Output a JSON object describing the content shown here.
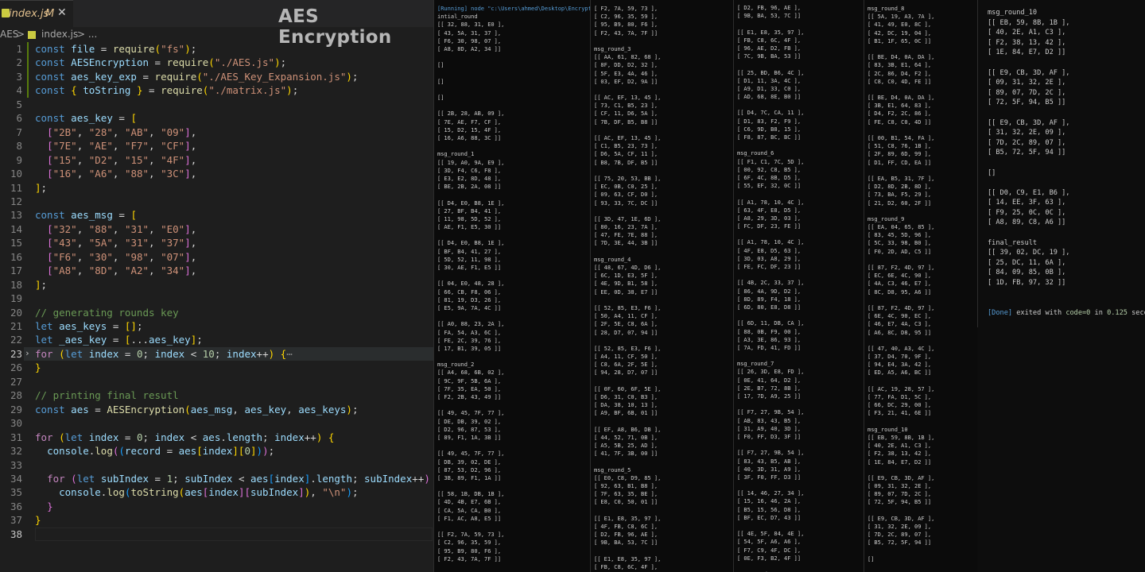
{
  "editor": {
    "tab_name": "index.js",
    "tab_modified": "M",
    "tab_close": "✕",
    "overlay_title": "AES Encryption",
    "breadcrumb": {
      "folder": "AES",
      "sep": ">",
      "file": "index.js",
      "tail": "> ..."
    },
    "folded_marker": "⋯",
    "lines": [
      {
        "n": "1",
        "html": "<span class='k'>const</span> <span class='v'>file</span> = <span class='f'>require</span><span class='b1'>(</span><span class='s'>\"fs\"</span><span class='b1'>)</span>;"
      },
      {
        "n": "2",
        "html": "<span class='k'>const</span> <span class='v'>AESEncryption</span> = <span class='f'>require</span><span class='b1'>(</span><span class='s'>\"./AES.js\"</span><span class='b1'>)</span>;"
      },
      {
        "n": "3",
        "html": "<span class='k'>const</span> <span class='v'>aes_key_exp</span> = <span class='f'>require</span><span class='b1'>(</span><span class='s'>\"./AES_Key_Expansion.js\"</span><span class='b1'>)</span>;"
      },
      {
        "n": "4",
        "html": "<span class='k'>const</span> <span class='b1'>{</span> <span class='v'>toString</span> <span class='b1'>}</span> = <span class='f'>require</span><span class='b1'>(</span><span class='s'>\"./matrix.js\"</span><span class='b1'>)</span>;"
      },
      {
        "n": "5",
        "html": ""
      },
      {
        "n": "6",
        "html": "<span class='k'>const</span> <span class='v'>aes_key</span> = <span class='b1'>[</span>"
      },
      {
        "n": "7",
        "html": "  <span class='b2'>[</span><span class='s'>\"2B\"</span>, <span class='s'>\"28\"</span>, <span class='s'>\"AB\"</span>, <span class='s'>\"09\"</span><span class='b2'>]</span>,"
      },
      {
        "n": "8",
        "html": "  <span class='b2'>[</span><span class='s'>\"7E\"</span>, <span class='s'>\"AE\"</span>, <span class='s'>\"F7\"</span>, <span class='s'>\"CF\"</span><span class='b2'>]</span>,"
      },
      {
        "n": "9",
        "html": "  <span class='b2'>[</span><span class='s'>\"15\"</span>, <span class='s'>\"D2\"</span>, <span class='s'>\"15\"</span>, <span class='s'>\"4F\"</span><span class='b2'>]</span>,"
      },
      {
        "n": "10",
        "html": "  <span class='b2'>[</span><span class='s'>\"16\"</span>, <span class='s'>\"A6\"</span>, <span class='s'>\"88\"</span>, <span class='s'>\"3C\"</span><span class='b2'>]</span>,"
      },
      {
        "n": "11",
        "html": "<span class='b1'>]</span>;"
      },
      {
        "n": "12",
        "html": ""
      },
      {
        "n": "13",
        "html": "<span class='k'>const</span> <span class='v'>aes_msg</span> = <span class='b1'>[</span>"
      },
      {
        "n": "14",
        "html": "  <span class='b2'>[</span><span class='s'>\"32\"</span>, <span class='s'>\"88\"</span>, <span class='s'>\"31\"</span>, <span class='s'>\"E0\"</span><span class='b2'>]</span>,"
      },
      {
        "n": "15",
        "html": "  <span class='b2'>[</span><span class='s'>\"43\"</span>, <span class='s'>\"5A\"</span>, <span class='s'>\"31\"</span>, <span class='s'>\"37\"</span><span class='b2'>]</span>,"
      },
      {
        "n": "16",
        "html": "  <span class='b2'>[</span><span class='s'>\"F6\"</span>, <span class='s'>\"30\"</span>, <span class='s'>\"98\"</span>, <span class='s'>\"07\"</span><span class='b2'>]</span>,"
      },
      {
        "n": "17",
        "html": "  <span class='b2'>[</span><span class='s'>\"A8\"</span>, <span class='s'>\"8D\"</span>, <span class='s'>\"A2\"</span>, <span class='s'>\"34\"</span><span class='b2'>]</span>,"
      },
      {
        "n": "18",
        "html": "<span class='b1'>]</span>;"
      },
      {
        "n": "19",
        "html": ""
      },
      {
        "n": "20",
        "html": "<span class='c'>// generating rounds key</span>"
      },
      {
        "n": "21",
        "html": "<span class='k'>let</span> <span class='v'>aes_keys</span> = <span class='b1'>[]</span>;"
      },
      {
        "n": "22",
        "html": "<span class='k'>let</span> <span class='v'>_aes_key</span> = <span class='b1'>[</span>...<span class='v'>aes_key</span><span class='b1'>]</span>;"
      },
      {
        "n": "23",
        "html": "<span class='cf'>for</span> <span class='b1'>(</span><span class='k'>let</span> <span class='v'>index</span> = <span class='n'>0</span>; <span class='v'>index</span> &lt; <span class='n'>10</span>; <span class='v'>index</span>++<span class='b1'>)</span> <span class='b1'>{</span><span class='fo'>⋯</span>"
      },
      {
        "n": "26",
        "html": "<span class='b1'>}</span>"
      },
      {
        "n": "27",
        "html": ""
      },
      {
        "n": "28",
        "html": "<span class='c'>// printing final resutl</span>"
      },
      {
        "n": "29",
        "html": "<span class='k'>const</span> <span class='v'>aes</span> = <span class='f'>AESEncryption</span><span class='b1'>(</span><span class='v'>aes_msg</span>, <span class='v'>aes_key</span>, <span class='v'>aes_keys</span><span class='b1'>)</span>;"
      },
      {
        "n": "30",
        "html": ""
      },
      {
        "n": "31",
        "html": "<span class='cf'>for</span> <span class='b1'>(</span><span class='k'>let</span> <span class='v'>index</span> = <span class='n'>0</span>; <span class='v'>index</span> &lt; <span class='v'>aes</span>.<span class='v'>length</span>; <span class='v'>index</span>++<span class='b1'>)</span> <span class='b1'>{</span>"
      },
      {
        "n": "32",
        "html": "  <span class='v'>console</span>.<span class='f'>log</span><span class='b2'>(</span><span class='b3'>(</span><span class='v'>record</span> = <span class='v'>aes</span><span class='b1'>[</span><span class='v'>index</span><span class='b1'>][</span><span class='n'>0</span><span class='b1'>]</span><span class='b3'>)</span><span class='b2'>)</span>;"
      },
      {
        "n": "33",
        "html": ""
      },
      {
        "n": "34",
        "html": "  <span class='cf'>for</span> <span class='b2'>(</span><span class='k'>let</span> <span class='v'>subIndex</span> = <span class='n'>1</span>; <span class='v'>subIndex</span> &lt; <span class='v'>aes</span><span class='b3'>[</span><span class='v'>index</span><span class='b3'>]</span>.<span class='v'>length</span>; <span class='v'>subIndex</span>++<span class='b2'>)</span> <span class='b2'>{</span>"
      },
      {
        "n": "35",
        "html": "    <span class='v'>console</span>.<span class='f'>log</span><span class='b3'>(</span><span class='f'>toString</span><span class='b1'>(</span><span class='v'>aes</span><span class='b2'>[</span><span class='v'>index</span><span class='b2'>][</span><span class='v'>subIndex</span><span class='b2'>]</span><span class='b1'>)</span>, <span class='s'>\"\\n\"</span><span class='b3'>)</span>;"
      },
      {
        "n": "36",
        "html": "  <span class='b2'>}</span>"
      },
      {
        "n": "37",
        "html": "<span class='b1'>}</span>"
      },
      {
        "n": "38",
        "html": ""
      }
    ]
  },
  "terminal": {
    "columns": [
      {
        "lines": [
          "[Running] node \"c:\\Users\\ahmed\\Desktop\\Encrypt",
          "intial_round",
          "[[ 32, 88, 31, E0 ],",
          "[ 43, 5A, 31, 37 ],",
          "[ F6, 30, 98, 07 ],",
          "[ A8, 8D, A2, 34 ]]",
          "",
          "[]",
          "",
          "[]",
          "",
          "[]",
          "",
          "[[ 2B, 28, AB, 09 ],",
          "[ 7E, AE, F7, CF ],",
          "[ 15, D2, 15, 4F ],",
          "[ 16, A6, 88, 3C ]]",
          "",
          "msg_round_1",
          "[[ 19, A0, 9A, E9 ],",
          "[ 3D, F4, C6, F8 ],",
          "[ E3, E2, 8D, 48 ],",
          "[ BE, 2B, 2A, 08 ]]",
          "",
          "[[ D4, E0, B8, 1E ],",
          "[ 27, BF, B4, 41 ],",
          "[ 11, 98, 5D, 52 ],",
          "[ AE, F1, E5, 30 ]]",
          "",
          "[[ D4, E0, B8, 1E ],",
          "[ BF, B4, 41, 27 ],",
          "[ 5D, 52, 11, 98 ],",
          "[ 30, AE, F1, E5 ]]",
          "",
          "[[ 04, E0, 48, 28 ],",
          "[ 66, CB, F8, 06 ],",
          "[ 81, 19, D3, 26 ],",
          "[ E5, 9A, 7A, 4C ]]",
          "",
          "[[ A0, 88, 23, 2A ],",
          "[ FA, 54, A3, 6C ],",
          "[ FE, 2C, 39, 76 ],",
          "[ 17, B1, 39, 05 ]]",
          "",
          "msg_round_2",
          "[[ A4, 68, 6B, 02 ],",
          "[ 9C, 9F, 5B, 6A ],",
          "[ 7F, 35, EA, 50 ],",
          "[ F2, 2B, 43, 49 ]]",
          "",
          "[[ 49, 45, 7F, 77 ],",
          "[ DE, DB, 39, 02 ],",
          "[ D2, 96, 87, 53 ],",
          "[ 89, F1, 1A, 3B ]]",
          "",
          "[[ 49, 45, 7F, 77 ],",
          "[ DB, 39, 02, DE ],",
          "[ 87, 53, D2, 96 ],",
          "[ 3B, 89, F1, 1A ]]",
          "",
          "[[ 58, 1B, DB, 1B ],",
          "[ 4D, 4B, E7, 6B ],",
          "[ CA, 5A, CA, B0 ],",
          "[ F1, AC, A8, E5 ]]",
          "",
          "[[ F2, 7A, 59, 73 ],",
          "[ C2, 96, 35, 59 ],",
          "[ 95, B9, 80, F6 ],",
          "[ F2, 43, 7A, 7F ]]"
        ]
      },
      {
        "lines": [
          "[ F2, 7A, 59, 73 ],",
          "[ C2, 96, 35, 59 ],",
          "[ 95, B9, 80, F6 ],",
          "[ F2, 43, 7A, 7F ]]",
          "",
          "msg_round_3",
          "[[ AA, 61, 82, 68 ],",
          "[ 8F, DD, D2, 32 ],",
          "[ 5F, E3, 4A, 46 ],",
          "[ 03, EF, D2, 9A ]]",
          "",
          "[[ AC, EF, 13, 45 ],",
          "[ 73, C1, B5, 23 ],",
          "[ CF, 11, D6, 5A ],",
          "[ 7B, DF, B5, B8 ]]",
          "",
          "[[ AC, EF, 13, 45 ],",
          "[ C1, B5, 23, 73 ],",
          "[ D6, 5A, CF, 11 ],",
          "[ B8, 7B, DF, B5 ]]",
          "",
          "[[ 75, 20, 53, BB ],",
          "[ EC, 0B, C0, 25 ],",
          "[ 09, 63, CF, D0 ],",
          "[ 93, 33, 7C, DC ]]",
          "",
          "[[ 3D, 47, 1E, 6D ],",
          "[ 80, 16, 23, 7A ],",
          "[ 47, FE, 7E, 88 ],",
          "[ 7D, 3E, 44, 3B ]]",
          "",
          "msg_round_4",
          "[[ 48, 67, 4D, D6 ],",
          "[ 6C, 1D, E3, 5F ],",
          "[ 4E, 9D, B1, 58 ],",
          "[ EE, 0D, 38, E7 ]]",
          "",
          "[[ 52, 85, E3, F6 ],",
          "[ 50, A4, 11, CF ],",
          "[ 2F, 5E, C8, 6A ],",
          "[ 28, D7, 07, 94 ]]",
          "",
          "[[ 52, 85, E3, F6 ],",
          "[ A4, 11, CF, 50 ],",
          "[ C8, 6A, 2F, 5E ],",
          "[ 94, 28, D7, 07 ]]",
          "",
          "[[ 0F, 60, 6F, 5E ],",
          "[ D6, 31, C0, B3 ],",
          "[ DA, 38, 10, 13 ],",
          "[ A9, BF, 6B, 01 ]]",
          "",
          "[[ EF, A8, B6, DB ],",
          "[ 44, 52, 71, 0B ],",
          "[ A5, 5B, 25, AD ],",
          "[ 41, 7F, 3B, 00 ]]",
          "",
          "msg_round_5",
          "[[ E0, C8, D9, 85 ],",
          "[ 92, 63, B1, B8 ],",
          "[ 7F, 63, 35, BE ],",
          "[ E8, C0, 50, 01 ]]",
          "",
          "[[ E1, E8, 35, 97 ],",
          "[ 4F, FB, C8, 6C ],",
          "[ D2, FB, 96, AE ],",
          "[ 9B, BA, 53, 7C ]]",
          "",
          "[[ E1, E8, 35, 97 ],",
          "[ FB, C8, 6C, 4F ],",
          "[ 96, AE, D2, FB ],",
          "[ 7C, 9B, BA, 53 ]]"
        ]
      },
      {
        "lines": [
          "[ D2, FB, 96, AE ],",
          "[ 9B, BA, 53, 7C ]]",
          "",
          "[[ E1, E8, 35, 97 ],",
          "[ FB, C8, 6C, 4F ],",
          "[ 96, AE, D2, FB ],",
          "[ 7C, 9B, BA, 53 ]]",
          "",
          "[[ 25, BD, B6, 4C ],",
          "[ D1, 11, 3A, 4C ],",
          "[ A9, D1, 33, C0 ],",
          "[ AD, 68, 8E, B0 ]]",
          "",
          "[[ D4, 7C, CA, 11 ],",
          "[ D1, 83, F2, F9 ],",
          "[ C6, 9D, B8, 15 ],",
          "[ F8, 87, BC, BC ]]",
          "",
          "msg_round_6",
          "[[ F1, C1, 7C, 5D ],",
          "[ 00, 92, C8, B5 ],",
          "[ 6F, 4C, 8B, D5 ],",
          "[ 55, EF, 32, 0C ]]",
          "",
          "[[ A1, 78, 10, 4C ],",
          "[ 63, 4F, E8, D5 ],",
          "[ A8, 29, 3D, 03 ],",
          "[ FC, DF, 23, FE ]]",
          "",
          "[[ A1, 78, 10, 4C ],",
          "[ 4F, E8, D5, 63 ],",
          "[ 3D, 03, A8, 29 ],",
          "[ FE, FC, DF, 23 ]]",
          "",
          "[[ 4B, 2C, 33, 37 ],",
          "[ 86, 4A, 9D, D2 ],",
          "[ 8D, 89, F4, 18 ],",
          "[ 6D, 80, E8, D8 ]]",
          "",
          "[[ 6D, 11, DB, CA ],",
          "[ 88, 0B, F9, 00 ],",
          "[ A3, 3E, 86, 93 ],",
          "[ 7A, FD, 41, FD ]]",
          "",
          "msg_round_7",
          "[[ 26, 3D, E8, FD ],",
          "[ 0E, 41, 64, D2 ],",
          "[ 2E, B7, 72, 8B ],",
          "[ 17, 7D, A9, 25 ]]",
          "",
          "[[ F7, 27, 9B, 54 ],",
          "[ AB, 83, 43, B5 ],",
          "[ 31, A9, 40, 3D ],",
          "[ F0, FF, D3, 3F ]]",
          "",
          "[[ F7, 27, 9B, 54 ],",
          "[ 83, 43, B5, AB ],",
          "[ 40, 3D, 31, A9 ],",
          "[ 3F, F0, FF, D3 ]]",
          "",
          "[[ 14, 46, 27, 34 ],",
          "[ 15, 16, 46, 2A ],",
          "[ B5, 15, 56, D8 ],",
          "[ BF, EC, D7, 43 ]]",
          "",
          "[[ 4E, 5F, 84, 4E ],",
          "[ 54, 5F, A6, A6 ],",
          "[ F7, C9, 4F, DC ],",
          "[ 0E, F3, B2, 4F ]]",
          "",
          "msg_round_8",
          "[[ 5A, 19, A3, 7A ],",
          "[ 41, 49, E0, 8C ],"
        ]
      },
      {
        "lines": [
          "msg_round_8",
          "[[ 5A, 19, A3, 7A ],",
          "[ 41, 49, E0, 8C ],",
          "[ 42, DC, 19, 04 ],",
          "[ B1, 1F, 65, 0C ]]",
          "",
          "[[ BE, D4, 0A, DA ],",
          "[ 83, 3B, E1, 64 ],",
          "[ 2C, 86, D4, F2 ],",
          "[ C8, C0, 4D, FE ]]",
          "",
          "[[ BE, D4, 0A, DA ],",
          "[ 3B, E1, 64, 83 ],",
          "[ D4, F2, 2C, 86 ],",
          "[ FE, C8, C0, 4D ]]",
          "",
          "[[ 00, B1, 54, FA ],",
          "[ 51, C8, 76, 1B ],",
          "[ 2F, 89, 6D, 99 ],",
          "[ D1, FF, CD, EA ]]",
          "",
          "[[ EA, B5, 31, 7F ],",
          "[ D2, 8D, 2B, 8D ],",
          "[ 73, BA, F5, 29 ],",
          "[ 21, D2, 60, 2F ]]",
          "",
          "msg_round_9",
          "[[ EA, 04, 65, 85 ],",
          "[ 83, 45, 5D, 96 ],",
          "[ 5C, 33, 98, B0 ],",
          "[ F0, 2D, AD, C5 ]]",
          "",
          "[[ 87, F2, 4D, 97 ],",
          "[ EC, 6E, 4C, 90 ],",
          "[ 4A, C3, 46, E7 ],",
          "[ 8C, D8, 95, A6 ]]",
          "",
          "[[ 87, F2, 4D, 97 ],",
          "[ 6E, 4C, 90, EC ],",
          "[ 46, E7, 4A, C3 ],",
          "[ A6, 8C, D8, 95 ]]",
          "",
          "[[ 47, 40, A3, 4C ],",
          "[ 37, D4, 70, 9F ],",
          "[ 94, E4, 3A, 42 ],",
          "[ ED, A5, A6, BC ]]",
          "",
          "[[ AC, 19, 28, 57 ],",
          "[ 77, FA, D1, 5C ],",
          "[ 66, DC, 29, 00 ],",
          "[ F3, 21, 41, 6E ]]",
          "",
          "msg_round_10",
          "[[ EB, 59, 8B, 1B ],",
          "[ 40, 2E, A1, C3 ],",
          "[ F2, 38, 13, 42 ],",
          "[ 1E, 84, E7, D2 ]]",
          "",
          "[[ E9, CB, 3D, AF ],",
          "[ 09, 31, 32, 2E ],",
          "[ 89, 07, 7D, 2C ],",
          "[ 72, 5F, 94, B5 ]]",
          "",
          "[[ E9, CB, 3D, AF ],",
          "[ 31, 32, 2E, 09 ],",
          "[ 7D, 2C, 89, 07 ],",
          "[ B5, 72, 5F, 94 ]]",
          "",
          "[]",
          "",
          "[[ D0, C9, E1, B6 ],",
          "[ 14, EE, 3F, 63 ],"
        ]
      }
    ],
    "last": {
      "lines": [
        "msg_round_10",
        "[[ EB, 59, 8B, 1B ],",
        "[ 40, 2E, A1, C3 ],",
        "[ F2, 38, 13, 42 ],",
        "[ 1E, 84, E7, D2 ]]",
        "",
        "[[ E9, CB, 3D, AF ],",
        "[ 09, 31, 32, 2E ],",
        "[ 89, 07, 7D, 2C ],",
        "[ 72, 5F, 94, B5 ]]",
        "",
        "[[ E9, CB, 3D, AF ],",
        "[ 31, 32, 2E, 09 ],",
        "[ 7D, 2C, 89, 07 ],",
        "[ B5, 72, 5F, 94 ]]",
        "",
        "[]",
        "",
        "[[ D0, C9, E1, B6 ],",
        "[ 14, EE, 3F, 63 ],",
        "[ F9, 25, 0C, 0C ],",
        "[ A8, 89, C8, A6 ]]",
        "",
        "final_result",
        "[[ 39, 02, DC, 19 ],",
        "[ 25, DC, 11, 6A ],",
        "[ 84, 09, 85, 0B ],",
        "[ 1D, FB, 97, 32 ]]",
        "",
        ""
      ],
      "done": {
        "tag": "[Done]",
        "text1": " exited with ",
        "code": "code=0",
        "text2": " in ",
        "time": "0.125",
        "text3": " seco"
      }
    }
  }
}
